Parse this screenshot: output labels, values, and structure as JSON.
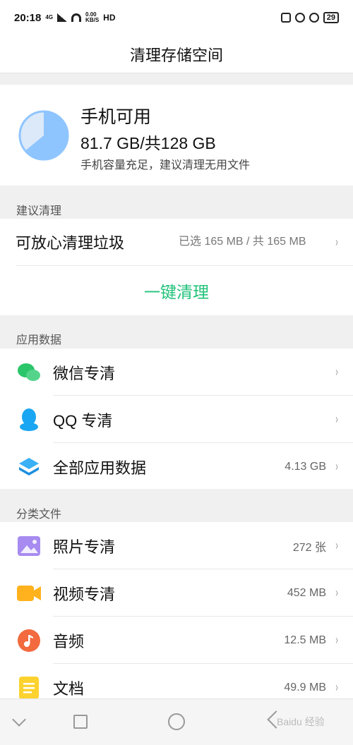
{
  "status_bar": {
    "time": "20:18",
    "network": "4G",
    "speed": "0.00",
    "speed_unit": "KB/S",
    "hd": "HD",
    "battery": "29"
  },
  "header": {
    "title": "清理存储空间"
  },
  "storage": {
    "title": "手机可用",
    "size": "81.7 GB/共128 GB",
    "note": "手机容量充足，建议清理无用文件",
    "used_fraction": 0.36,
    "colors": {
      "available": "#8fc5ff",
      "used": "#dce9f8"
    }
  },
  "suggested": {
    "section_label": "建议清理",
    "item_label": "可放心清理垃圾",
    "item_value": "已选 165 MB / 共 165 MB",
    "action_label": "一键清理",
    "action_color": "#21c27a"
  },
  "app_data": {
    "section_label": "应用数据",
    "items": [
      {
        "label": "微信专清",
        "value": "",
        "icon": "wechat-icon"
      },
      {
        "label": "QQ 专清",
        "value": "",
        "icon": "qq-icon"
      },
      {
        "label": "全部应用数据",
        "value": "4.13 GB",
        "icon": "layers-icon"
      }
    ]
  },
  "files": {
    "section_label": "分类文件",
    "items": [
      {
        "label": "照片专清",
        "value": "272 张",
        "icon": "photo-icon"
      },
      {
        "label": "视频专清",
        "value": "452 MB",
        "icon": "video-icon"
      },
      {
        "label": "音频",
        "value": "12.5 MB",
        "icon": "music-icon"
      },
      {
        "label": "文档",
        "value": "49.9 MB",
        "icon": "document-icon"
      }
    ]
  },
  "chevron": "›",
  "watermark": "Baidu 经验"
}
